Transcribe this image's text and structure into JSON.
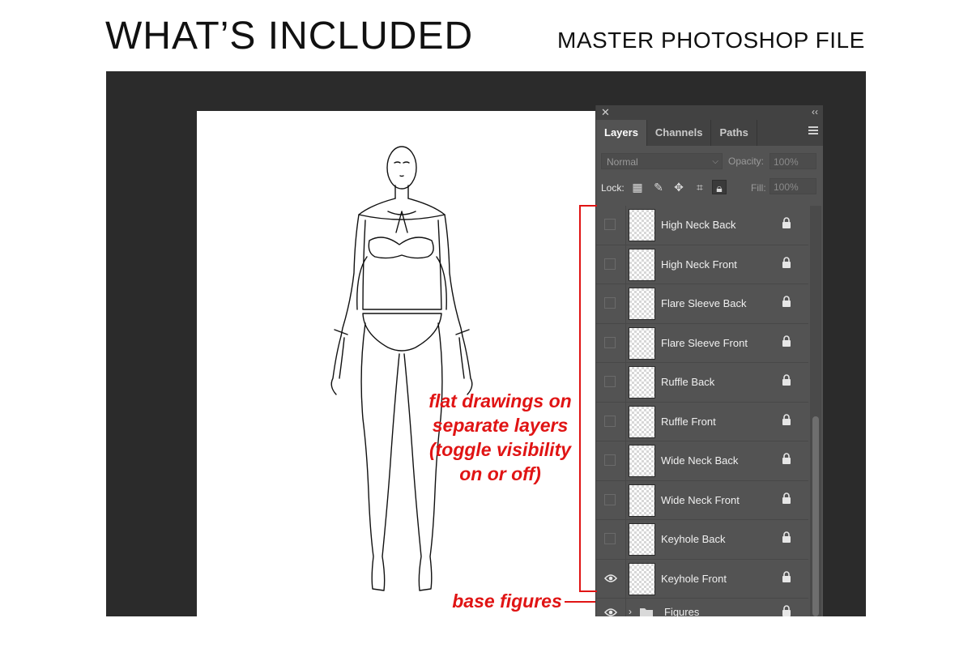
{
  "header": {
    "title": "WHAT’S INCLUDED",
    "subtitle": "MASTER PHOTOSHOP FILE"
  },
  "panel": {
    "tabs": [
      "Layers",
      "Channels",
      "Paths"
    ],
    "blend_mode": "Normal",
    "opacity_label": "Opacity:",
    "opacity_value": "100%",
    "lock_label": "Lock:",
    "fill_label": "Fill:",
    "fill_value": "100%",
    "layers": [
      {
        "name": "High Neck Back",
        "visible": false
      },
      {
        "name": "High Neck Front",
        "visible": false
      },
      {
        "name": "Flare Sleeve Back",
        "visible": false
      },
      {
        "name": "Flare Sleeve Front",
        "visible": false
      },
      {
        "name": "Ruffle Back",
        "visible": false
      },
      {
        "name": "Ruffle Front",
        "visible": false
      },
      {
        "name": "Wide Neck Back",
        "visible": false
      },
      {
        "name": "Wide Neck Front",
        "visible": false
      },
      {
        "name": "Keyhole Back",
        "visible": false
      },
      {
        "name": "Keyhole Front",
        "visible": true
      }
    ],
    "group": {
      "name": "Figures",
      "visible": true
    }
  },
  "annotations": {
    "layers_note": [
      "flat drawings on",
      "separate layers",
      "(toggle visibility",
      "on or off)"
    ],
    "figures_note": "base figures",
    "color": "#e01414"
  }
}
